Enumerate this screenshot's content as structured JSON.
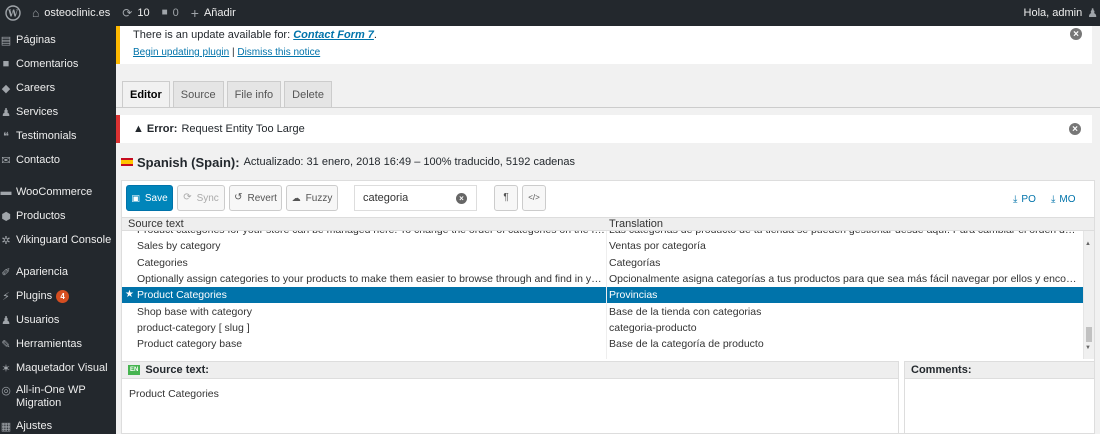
{
  "adminbar": {
    "site_name": "osteoclinic.es",
    "updates_count": "10",
    "comments_count": "0",
    "add_new_label": "Añadir",
    "greeting": "Hola, admin"
  },
  "sidebar": {
    "items": [
      {
        "label": "Páginas",
        "icon": "pages-icon",
        "glyph": "▤"
      },
      {
        "label": "Comentarios",
        "icon": "comments-icon",
        "glyph": "■"
      },
      {
        "label": "Careers",
        "icon": "careers-icon",
        "glyph": "◆"
      },
      {
        "label": "Services",
        "icon": "services-icon",
        "glyph": "♟"
      },
      {
        "label": "Testimonials",
        "icon": "quote-icon",
        "glyph": "❝"
      },
      {
        "label": "Contacto",
        "icon": "mail-icon",
        "glyph": "✉"
      },
      {
        "label": "WooCommerce",
        "icon": "woocommerce-icon",
        "glyph": "▬"
      },
      {
        "label": "Productos",
        "icon": "products-icon",
        "glyph": "⬢"
      },
      {
        "label": "Vikinguard Console",
        "icon": "gear-icon",
        "glyph": "✲"
      },
      {
        "label": "Apariencia",
        "icon": "appearance-icon",
        "glyph": "✐"
      },
      {
        "label": "Plugins",
        "icon": "plugins-icon",
        "glyph": "⚡",
        "badge": "4"
      },
      {
        "label": "Usuarios",
        "icon": "users-icon",
        "glyph": "♟"
      },
      {
        "label": "Herramientas",
        "icon": "tools-icon",
        "glyph": "✎"
      },
      {
        "label": "Maquetador Visual",
        "icon": "builder-icon",
        "glyph": "✶"
      },
      {
        "label": "All-in-One WP Migration",
        "icon": "migration-icon",
        "glyph": "◎"
      },
      {
        "label": "Ajustes",
        "icon": "settings-icon",
        "glyph": "▦"
      }
    ]
  },
  "notice_update": {
    "text": "There is an update available for:",
    "plugin": "Contact Form 7",
    "period": ".",
    "begin_link": "Begin updating plugin",
    "separator": " | ",
    "dismiss_link": "Dismiss this notice"
  },
  "tabs": [
    {
      "label": "Editor",
      "active": true
    },
    {
      "label": "Source",
      "active": false
    },
    {
      "label": "File info",
      "active": false
    },
    {
      "label": "Delete",
      "active": false
    }
  ],
  "error": {
    "label": "Error:",
    "message": "Request Entity Too Large"
  },
  "language": {
    "name": "Spanish (Spain):",
    "info": "Actualizado: 31 enero, 2018 16:49 – 100% traducido, 5192 cadenas"
  },
  "toolbar": {
    "save": "Save",
    "sync": "Sync",
    "revert": "Revert",
    "fuzzy": "Fuzzy",
    "search_value": "categoria",
    "download_po": "PO",
    "download_mo": "MO"
  },
  "table": {
    "col_source": "Source text",
    "col_translation": "Translation",
    "rows": [
      {
        "source": "Product categories for your store can be managed here. To change the order of categories on the front-e...",
        "translation": "Las categorías de producto de tu tienda se pueden gestionar desde aquí. Para cambiar el orden de las cate..."
      },
      {
        "source": "Sales by category",
        "translation": "Ventas por categoría"
      },
      {
        "source": "Categories",
        "translation": "Categorías"
      },
      {
        "source": "Optionally assign categories to your products to make them easier to browse through and find in your st...",
        "translation": "Opcionalmente asigna categorías a tus productos para que sea más fácil navegar por ellos y encontrarlos e..."
      },
      {
        "source": "Product Categories",
        "translation": "Provincias",
        "selected": true
      },
      {
        "source": "Shop base with category",
        "translation": "Base de la tienda con categorias"
      },
      {
        "source": "product-category [ slug ]",
        "translation": "categoria-producto"
      },
      {
        "source": "Product category base",
        "translation": "Base de la categoría de producto"
      }
    ]
  },
  "source_pane": {
    "badge": "EN",
    "title": "Source text:",
    "text": "Product Categories"
  },
  "comments_pane": {
    "title": "Comments:"
  },
  "colors": {
    "adminbar": "#23282d",
    "primary": "#0085ba",
    "selected_row": "#0073aa",
    "warning": "#ffb900",
    "error": "#dc3232",
    "badge": "#d54e21"
  }
}
